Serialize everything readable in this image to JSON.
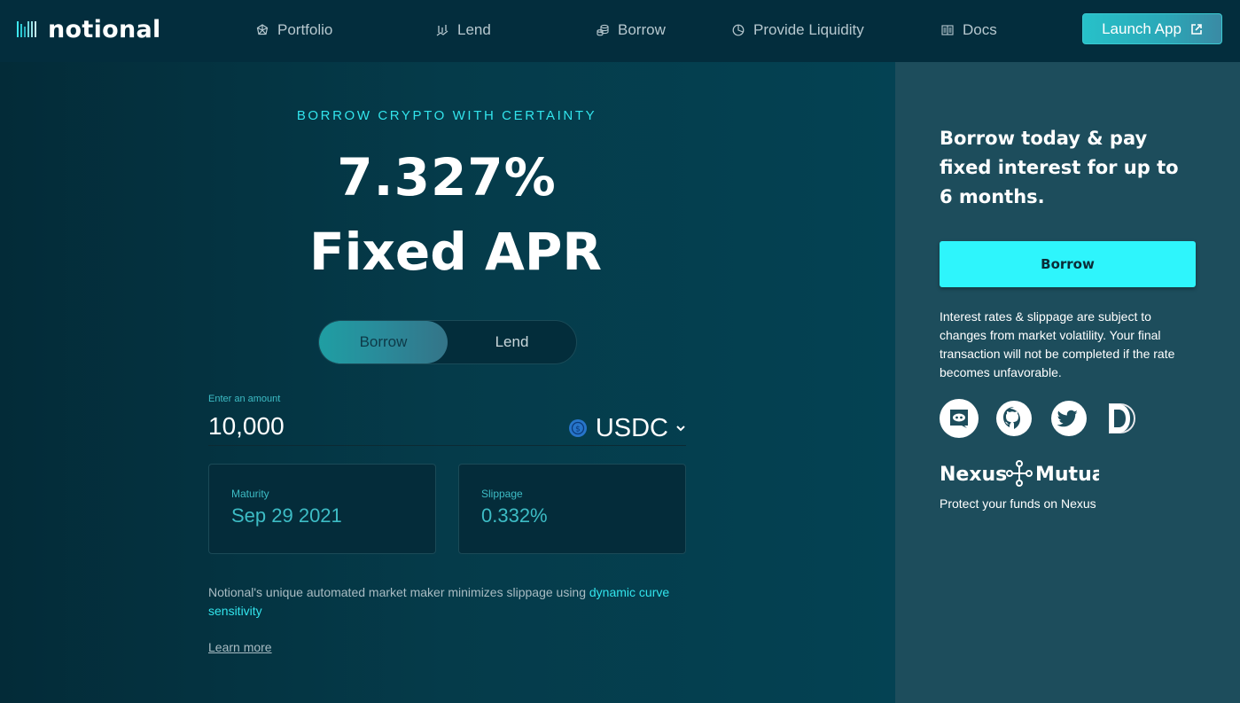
{
  "header": {
    "brand": "notional",
    "nav": [
      {
        "label": "Portfolio",
        "icon": "portfolio-icon"
      },
      {
        "label": "Lend",
        "icon": "lend-chart-icon"
      },
      {
        "label": "Borrow",
        "icon": "coins-stack-icon"
      },
      {
        "label": "Provide Liquidity",
        "icon": "pie-chart-icon"
      },
      {
        "label": "Docs",
        "icon": "book-icon"
      }
    ],
    "launch_label": "Launch App",
    "launch_icon": "external-link-icon"
  },
  "hero": {
    "eyebrow": "BORROW CRYPTO WITH CERTAINTY",
    "rate": "7.327%",
    "rate_label": "Fixed APR"
  },
  "toggle": {
    "options": [
      "Borrow",
      "Lend"
    ],
    "selected": "Borrow"
  },
  "amount": {
    "label": "Enter an amount",
    "value": "10,000",
    "currency": "USDC",
    "currency_icon": "usdc-coin-icon"
  },
  "stats": [
    {
      "label": "Maturity",
      "value": "Sep 29 2021"
    },
    {
      "label": "Slippage",
      "value": "0.332%"
    }
  ],
  "blurb": {
    "text": "Notional's unique automated market maker minimizes slippage using ",
    "link": "dynamic curve sensitivity"
  },
  "learn_more": "Learn more",
  "side": {
    "title": "Borrow today & pay fixed interest for up to 6 months.",
    "button": "Borrow",
    "note": "Interest rates & slippage are subject to changes from market volatility. Your final transaction will not be completed if the rate becomes unfavorable.",
    "socials": [
      "discord-icon",
      "github-icon",
      "twitter-icon",
      "defi-pulse-icon"
    ],
    "nexus_brand": "Nexus Mutual",
    "nexus_caption": "Protect your funds on Nexus"
  },
  "colors": {
    "accent": "#2ef5fc",
    "header_bg": "#032d3d",
    "side_bg": "#1d4d5c",
    "stat_text": "#3dbcc5"
  }
}
